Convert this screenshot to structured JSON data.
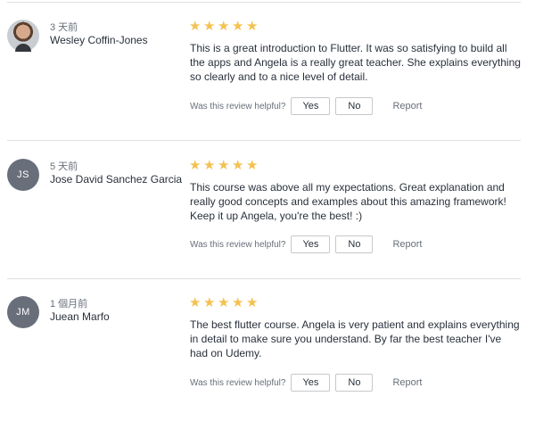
{
  "reviews": [
    {
      "avatar_initials": "",
      "time": "3 天前",
      "name": "Wesley Coffin-Jones",
      "rating": 5,
      "content": "This is a great introduction to Flutter. It was so satisfying to build all the apps and Angela is a really great teacher. She explains everything so clearly and to a nice level of detail.",
      "helpful_question": "Was this review helpful?",
      "yes_label": "Yes",
      "no_label": "No",
      "report_label": "Report"
    },
    {
      "avatar_initials": "JS",
      "time": "5 天前",
      "name": "Jose David Sanchez Garcia",
      "rating": 5,
      "content": "This course was above all my expectations. Great explanation and really good concepts and examples about this amazing framework! Keep it up Angela, you're the best! :)",
      "helpful_question": "Was this review helpful?",
      "yes_label": "Yes",
      "no_label": "No",
      "report_label": "Report"
    },
    {
      "avatar_initials": "JM",
      "time": "1 個月前",
      "name": "Juean Marfo",
      "rating": 5,
      "content": "The best flutter course. Angela is very patient and explains everything in detail to make sure you understand. By far the best teacher I've had on Udemy.",
      "helpful_question": "Was this review helpful?",
      "yes_label": "Yes",
      "no_label": "No",
      "report_label": "Report"
    }
  ],
  "colors": {
    "star": "#f4c150",
    "avatar_bg": "#686f7a",
    "divider": "#dedfe0"
  },
  "icons": {
    "star": "star-icon"
  }
}
